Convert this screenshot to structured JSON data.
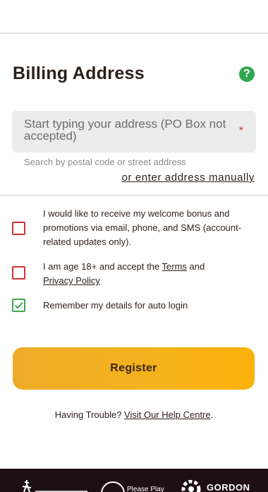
{
  "billing": {
    "title": "Billing Address",
    "help_icon": "question-mark-icon",
    "address_placeholder": "Start typing your address (PO Box not accepted)",
    "required_marker": "*",
    "helper_text": "Search by postal code or street address",
    "manual_link": "or enter address manually"
  },
  "consents": {
    "marketing_label": "I would like to receive my welcome bonus and promotions via email, phone, and SMS (account-related updates only).",
    "marketing_checked": false,
    "age_prefix": "I am age 18+ and accept the ",
    "terms_link": "Terms",
    "age_and": " and",
    "privacy_link": "Privacy Policy",
    "age_checked": false,
    "remember_label": "Remember my details for auto login",
    "remember_checked": true
  },
  "actions": {
    "register_label": "Register"
  },
  "help": {
    "prefix": "Having Trouble? ",
    "link": "Visit Our Help Centre",
    "suffix": "."
  },
  "footer": {
    "mid_text": "Please Play",
    "right_text": "GORDON"
  },
  "colors": {
    "accent_yellow": "#f6b31c",
    "help_green": "#2fa84f",
    "error_red": "#d13232",
    "checked_green": "#3aa84c",
    "footer_bg": "#1e0f14"
  }
}
